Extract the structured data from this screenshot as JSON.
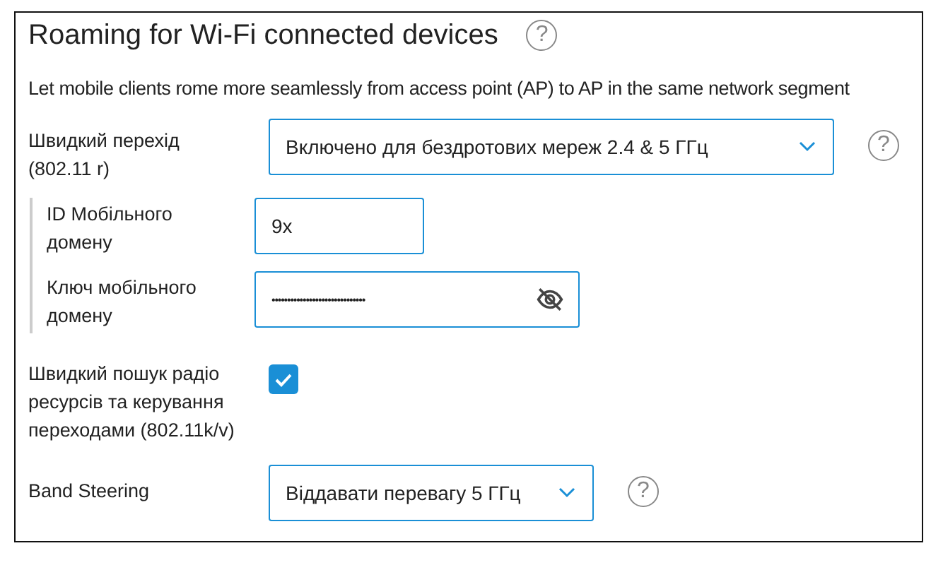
{
  "section": {
    "title": "Roaming for Wi-Fi connected devices",
    "help": "?",
    "description": "Let mobile clients rome more seamlessly from access point (AP) to AP in the same network segment"
  },
  "rows": [
    {
      "kind": "select",
      "label": "Швидкий перехід (802.11 r)",
      "value": "Включено для бездротових мереж 2.4 & 5 ГГц",
      "wide": true,
      "help": "?",
      "indented": false
    },
    {
      "kind": "text",
      "label": "ID Мобільного домену",
      "value": "9x",
      "indented": true
    },
    {
      "kind": "password",
      "label": "Ключ мобільного домену",
      "value": "••••••••••••••••••••••••••••••",
      "indented": true
    },
    {
      "kind": "checkbox",
      "label": "Швидкий пошук радіо ресурсів та керування переходами (802.11k/v)",
      "checked": true,
      "indented": false
    },
    {
      "kind": "select",
      "label": "Band Steering",
      "value": "Віддавати перевагу 5 ГГц",
      "wide": false,
      "help": "?",
      "indented": false
    }
  ]
}
